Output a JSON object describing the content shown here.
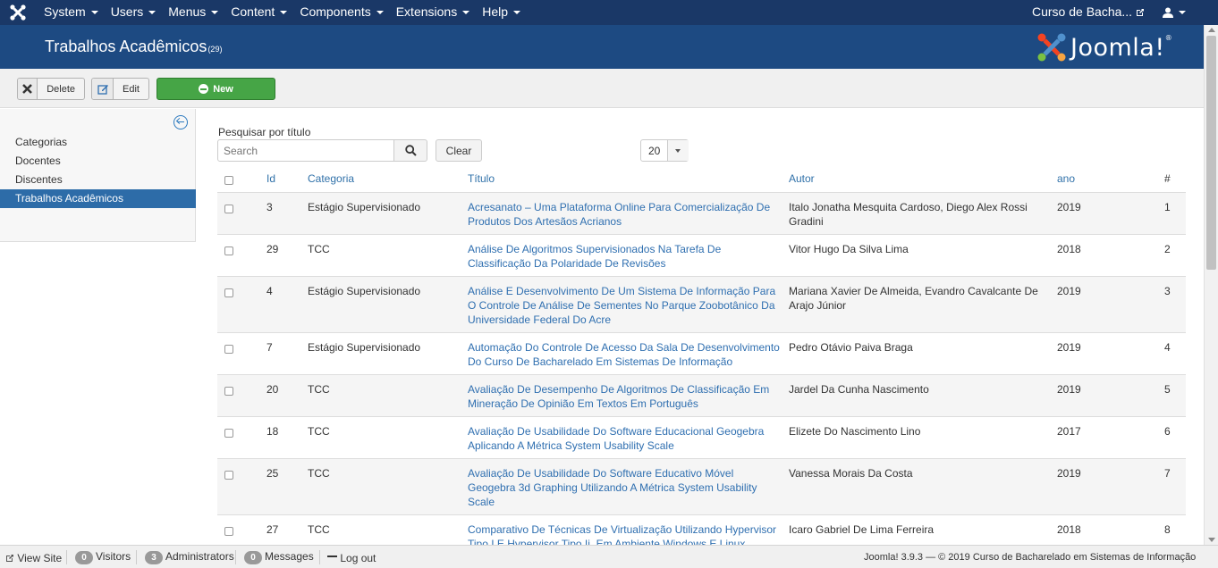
{
  "menu": {
    "items": [
      "System",
      "Users",
      "Menus",
      "Content",
      "Components",
      "Extensions",
      "Help"
    ],
    "site_link": "Curso de Bacha..."
  },
  "header": {
    "title": "Trabalhos Acadêmicos",
    "count": "(29)",
    "brand": "Joomla!",
    "brand_mark": "®"
  },
  "toolbar": {
    "delete_label": "Delete",
    "edit_label": "Edit",
    "new_label": "New"
  },
  "sidebar": {
    "items": [
      {
        "label": "Categorias",
        "active": false
      },
      {
        "label": "Docentes",
        "active": false
      },
      {
        "label": "Discentes",
        "active": false
      },
      {
        "label": "Trabalhos Acadêmicos",
        "active": true
      }
    ]
  },
  "filters": {
    "search_label": "Pesquisar por título",
    "search_placeholder": "Search",
    "clear_label": "Clear",
    "limit": "20"
  },
  "table": {
    "headers": {
      "id": "Id",
      "categoria": "Categoria",
      "titulo": "Título",
      "autor": "Autor",
      "ano": "ano",
      "num": "#"
    },
    "rows": [
      {
        "id": "3",
        "categoria": "Estágio Supervisionado",
        "titulo": [
          "Acresanato – Uma Plataforma Online Para Comercialização De",
          "Produtos Dos Artesãos Acrianos"
        ],
        "autor": [
          "Italo Jonatha Mesquita Cardoso, Diego Alex Rossi",
          "Gradini"
        ],
        "ano": "2019",
        "num": "1"
      },
      {
        "id": "29",
        "categoria": "TCC",
        "titulo": [
          "Análise De Algoritmos Supervisionados Na Tarefa De",
          "Classificação Da Polaridade De Revisões"
        ],
        "autor": [
          "Vitor Hugo Da Silva Lima"
        ],
        "ano": "2018",
        "num": "2"
      },
      {
        "id": "4",
        "categoria": "Estágio Supervisionado",
        "titulo": [
          "Análise E Desenvolvimento De Um Sistema De Informação Para",
          "O Controle De Análise De Sementes No Parque Zoobotânico Da",
          "Universidade Federal Do Acre"
        ],
        "autor": [
          "Mariana Xavier De Almeida, Evandro Cavalcante De",
          "Arajo Júnior"
        ],
        "ano": "2019",
        "num": "3"
      },
      {
        "id": "7",
        "categoria": "Estágio Supervisionado",
        "titulo": [
          "Automação Do Controle De Acesso Da Sala De Desenvolvimento",
          "Do Curso De Bacharelado Em Sistemas De Informação"
        ],
        "autor": [
          "Pedro Otávio Paiva Braga"
        ],
        "ano": "2019",
        "num": "4"
      },
      {
        "id": "20",
        "categoria": "TCC",
        "titulo": [
          "Avaliação De Desempenho De Algoritmos De Classificação Em",
          "Mineração De Opinião Em Textos Em Português"
        ],
        "autor": [
          "Jardel Da Cunha Nascimento"
        ],
        "ano": "2019",
        "num": "5"
      },
      {
        "id": "18",
        "categoria": "TCC",
        "titulo": [
          "Avaliação De Usabilidade Do Software Educacional Geogebra",
          "Aplicando A Métrica System Usability Scale"
        ],
        "autor": [
          "Elizete Do Nascimento Lino"
        ],
        "ano": "2017",
        "num": "6"
      },
      {
        "id": "25",
        "categoria": "TCC",
        "titulo": [
          "Avaliação De Usabilidade Do Software Educativo Móvel",
          "Geogebra 3d Graphing Utilizando A Métrica System Usability",
          "Scale"
        ],
        "autor": [
          "Vanessa Morais Da Costa"
        ],
        "ano": "2019",
        "num": "7"
      },
      {
        "id": "27",
        "categoria": "TCC",
        "titulo": [
          "Comparativo De Técnicas De Virtualização Utilizando Hypervisor",
          "Tipo I E Hypervisor Tipo Ii, Em Ambiente Windows E Linux"
        ],
        "autor": [
          "Icaro Gabriel De Lima Ferreira"
        ],
        "ano": "2018",
        "num": "8"
      }
    ]
  },
  "statusbar": {
    "view_site": "View Site",
    "visitors_count": "0",
    "visitors_label": "Visitors",
    "admins_count": "3",
    "admins_label": "Administrators",
    "messages_count": "0",
    "messages_label": "Messages",
    "logout": "Log out",
    "footer": "Joomla! 3.9.3  —  © 2019 Curso de Bacharelado em Sistemas de Informação"
  },
  "colors": {
    "topbar": "#1a3867",
    "header": "#1d4a82",
    "new_button": "#46a546",
    "link": "#2f6fb0",
    "active_nav": "#2d6ca8"
  }
}
